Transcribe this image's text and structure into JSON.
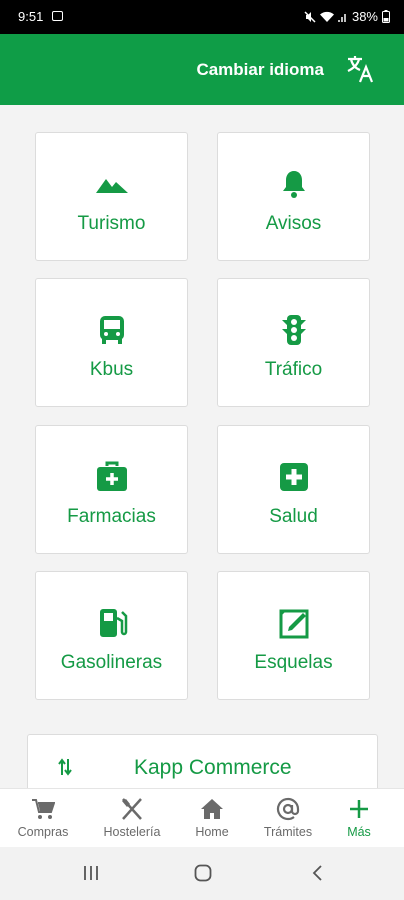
{
  "status": {
    "time": "9:51",
    "battery": "38%"
  },
  "header": {
    "change_language": "Cambiar idioma"
  },
  "tiles": [
    {
      "label": "Turismo",
      "icon": "mountain-icon"
    },
    {
      "label": "Avisos",
      "icon": "bell-icon"
    },
    {
      "label": "Kbus",
      "icon": "bus-icon"
    },
    {
      "label": "Tráfico",
      "icon": "traffic-light-icon"
    },
    {
      "label": "Farmacias",
      "icon": "medical-kit-icon"
    },
    {
      "label": "Salud",
      "icon": "health-cross-icon"
    },
    {
      "label": "Gasolineras",
      "icon": "fuel-pump-icon"
    },
    {
      "label": "Esquelas",
      "icon": "obituary-icon"
    }
  ],
  "commerce": {
    "label": "Kapp Commerce",
    "icon": "swap-vertical-icon"
  },
  "bottom_nav": [
    {
      "label": "Compras",
      "icon": "cart-icon"
    },
    {
      "label": "Hostelería",
      "icon": "utensils-icon"
    },
    {
      "label": "Home",
      "icon": "home-icon"
    },
    {
      "label": "Trámites",
      "icon": "at-icon"
    },
    {
      "label": "Más",
      "icon": "plus-icon",
      "active": true
    }
  ],
  "colors": {
    "primary": "#0f9d47",
    "accent_text": "#159a45",
    "background": "#f3f3f3"
  }
}
